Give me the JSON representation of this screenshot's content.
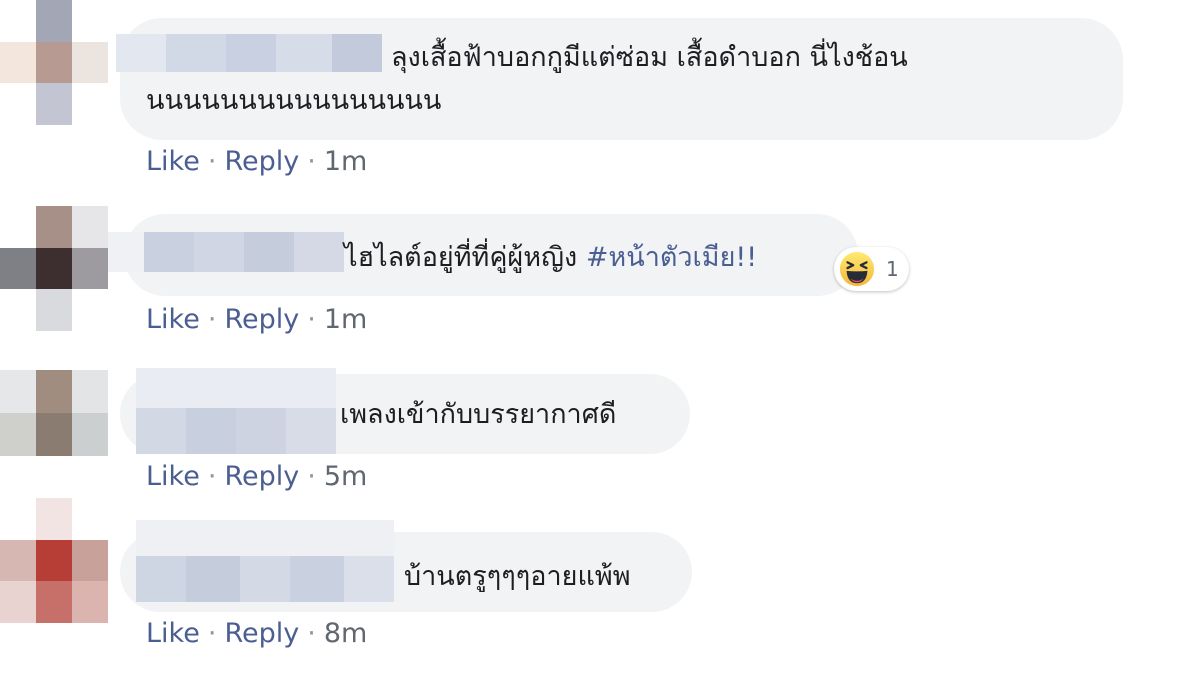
{
  "comments": [
    {
      "text_line1": "ลุงเสื้อฟ้าบอกกูมีแต่ซ่อม เสื้อดำบอก นี่ไงช้อน",
      "text_line2": "นนนนนนนนนนนนนนนน",
      "like": "Like",
      "reply": "Reply",
      "dot": "·",
      "time": "1m"
    },
    {
      "text": "ไฮไลต์อยู่ที่ที่คู่ผู้หญิง",
      "hashtag": "#หน้าตัวเมีย!!",
      "reaction_icon": "haha-emoji-icon",
      "reaction_count": "1",
      "like": "Like",
      "reply": "Reply",
      "dot": "·",
      "time": "1m"
    },
    {
      "text": "เพลงเข้ากับบรรยากาศดี",
      "like": "Like",
      "reply": "Reply",
      "dot": "·",
      "time": "5m"
    },
    {
      "text": "บ้านตรูๆๆๆอายแพ้พ",
      "like": "Like",
      "reply": "Reply",
      "dot": "·",
      "time": "8m"
    }
  ],
  "colors": {
    "bubble": "#f2f3f5",
    "link": "#4b5e91",
    "text": "#1c1e21",
    "meta": "#606770"
  }
}
